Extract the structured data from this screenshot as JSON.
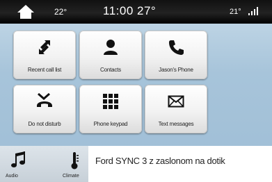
{
  "status_bar": {
    "home_icon": "home-icon",
    "temp_left": "22°",
    "clock": "11:00 27°",
    "temp_right": "21°",
    "signal_icon": "signal-bars-icon"
  },
  "tiles": [
    {
      "label": "Recent call list",
      "icon": "recent-calls-icon"
    },
    {
      "label": "Contacts",
      "icon": "contact-person-icon"
    },
    {
      "label": "Jason's Phone",
      "icon": "phone-handset-icon"
    },
    {
      "label": "Do not disturb",
      "icon": "do-not-disturb-icon"
    },
    {
      "label": "Phone keypad",
      "icon": "keypad-icon"
    },
    {
      "label": "Text messages",
      "icon": "envelope-icon"
    }
  ],
  "bottom_bar": {
    "audio_label": "Audio",
    "audio_icon": "music-note-icon",
    "climate_label": "Climate",
    "climate_icon": "thermometer-icon"
  },
  "caption": "Ford SYNC 3 z zaslonom na dotik",
  "colors": {
    "status_bar": "#111111",
    "screen_background": "#a7c4da",
    "tile_background": "#f2f2f2",
    "icon_color": "#111111"
  }
}
